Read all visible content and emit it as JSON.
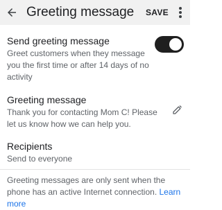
{
  "toolbar": {
    "back_icon": "arrow-back-icon",
    "title": "Greeting message",
    "save_label": "SAVE",
    "more_icon": "more-vert-icon"
  },
  "send_greeting": {
    "title": "Send greeting message",
    "description": "Greet customers when they message you the first time or after 14 days of no activity",
    "toggle_on": true
  },
  "greeting_message": {
    "title": "Greeting message",
    "text": "Thank you for contacting Mom C! Please let us know how we can help you.",
    "edit_icon": "pencil-icon"
  },
  "recipients": {
    "title": "Recipients",
    "value": "Send to everyone"
  },
  "footer": {
    "note": "Greeting messages are only sent when the phone has an active Internet connection.",
    "link_label": "Learn more"
  },
  "colors": {
    "toolbar_bg": "#f1f1f1",
    "toggle_on": "#1f1f1f",
    "link": "#1a73e8"
  }
}
